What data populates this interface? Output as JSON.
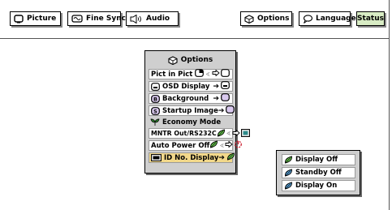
{
  "tabs": [
    {
      "label": "Picture",
      "icon": "picture-icon"
    },
    {
      "label": "Fine Sync",
      "icon": "fine-sync-icon"
    },
    {
      "label": "Audio",
      "icon": "speaker-icon"
    },
    {
      "label": "Options",
      "icon": "options-icon"
    },
    {
      "label": "Language",
      "icon": "speech-bubble-icon"
    },
    {
      "label": "Status",
      "icon": ""
    }
  ],
  "menu": {
    "title": "Options",
    "items": [
      {
        "label": "Pict in Pict"
      },
      {
        "label": "OSD Display"
      },
      {
        "label": "Background"
      },
      {
        "label": "Startup Image"
      },
      {
        "label": "Economy Mode"
      },
      {
        "label": "MNTR Out/RS232C"
      },
      {
        "label": "Auto Power Off"
      },
      {
        "label": "ID No. Display"
      }
    ]
  },
  "submenu": {
    "items": [
      {
        "label": "Display Off"
      },
      {
        "label": "Standby Off"
      },
      {
        "label": "Display On"
      }
    ]
  },
  "colors": {
    "selected_row": "#f2d88a",
    "status_tab": "#d8ecc4",
    "panel": "#cfcfcf"
  }
}
